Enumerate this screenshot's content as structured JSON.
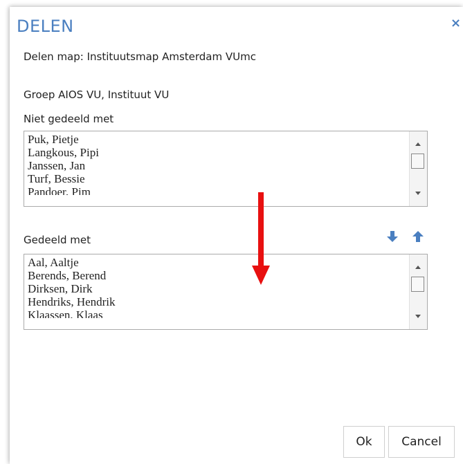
{
  "dialog": {
    "title": "DELEN",
    "close_symbol": "×",
    "subtitle": "Delen map: Instituutsmap Amsterdam VUmc",
    "group": "Groep  AIOS VU, Instituut VU"
  },
  "not_shared": {
    "label": "Niet gedeeld met",
    "items": [
      "Puk, Pietje",
      "Langkous, Pipi",
      "Janssen, Jan",
      "Turf, Bessie",
      "Pandoer, Pim"
    ]
  },
  "shared": {
    "label": "Gedeeld met",
    "items": [
      "Aal, Aaltje",
      "Berends, Berend",
      "Dirksen, Dirk",
      "Hendriks, Hendrik",
      "Klaassen, Klaas"
    ]
  },
  "actions": {
    "move_down_icon": "arrow-down-icon",
    "move_up_icon": "arrow-up-icon",
    "ok_label": "Ok",
    "cancel_label": "Cancel"
  },
  "colors": {
    "accent": "#4a7fc0",
    "annotation_arrow": "#e81010"
  }
}
